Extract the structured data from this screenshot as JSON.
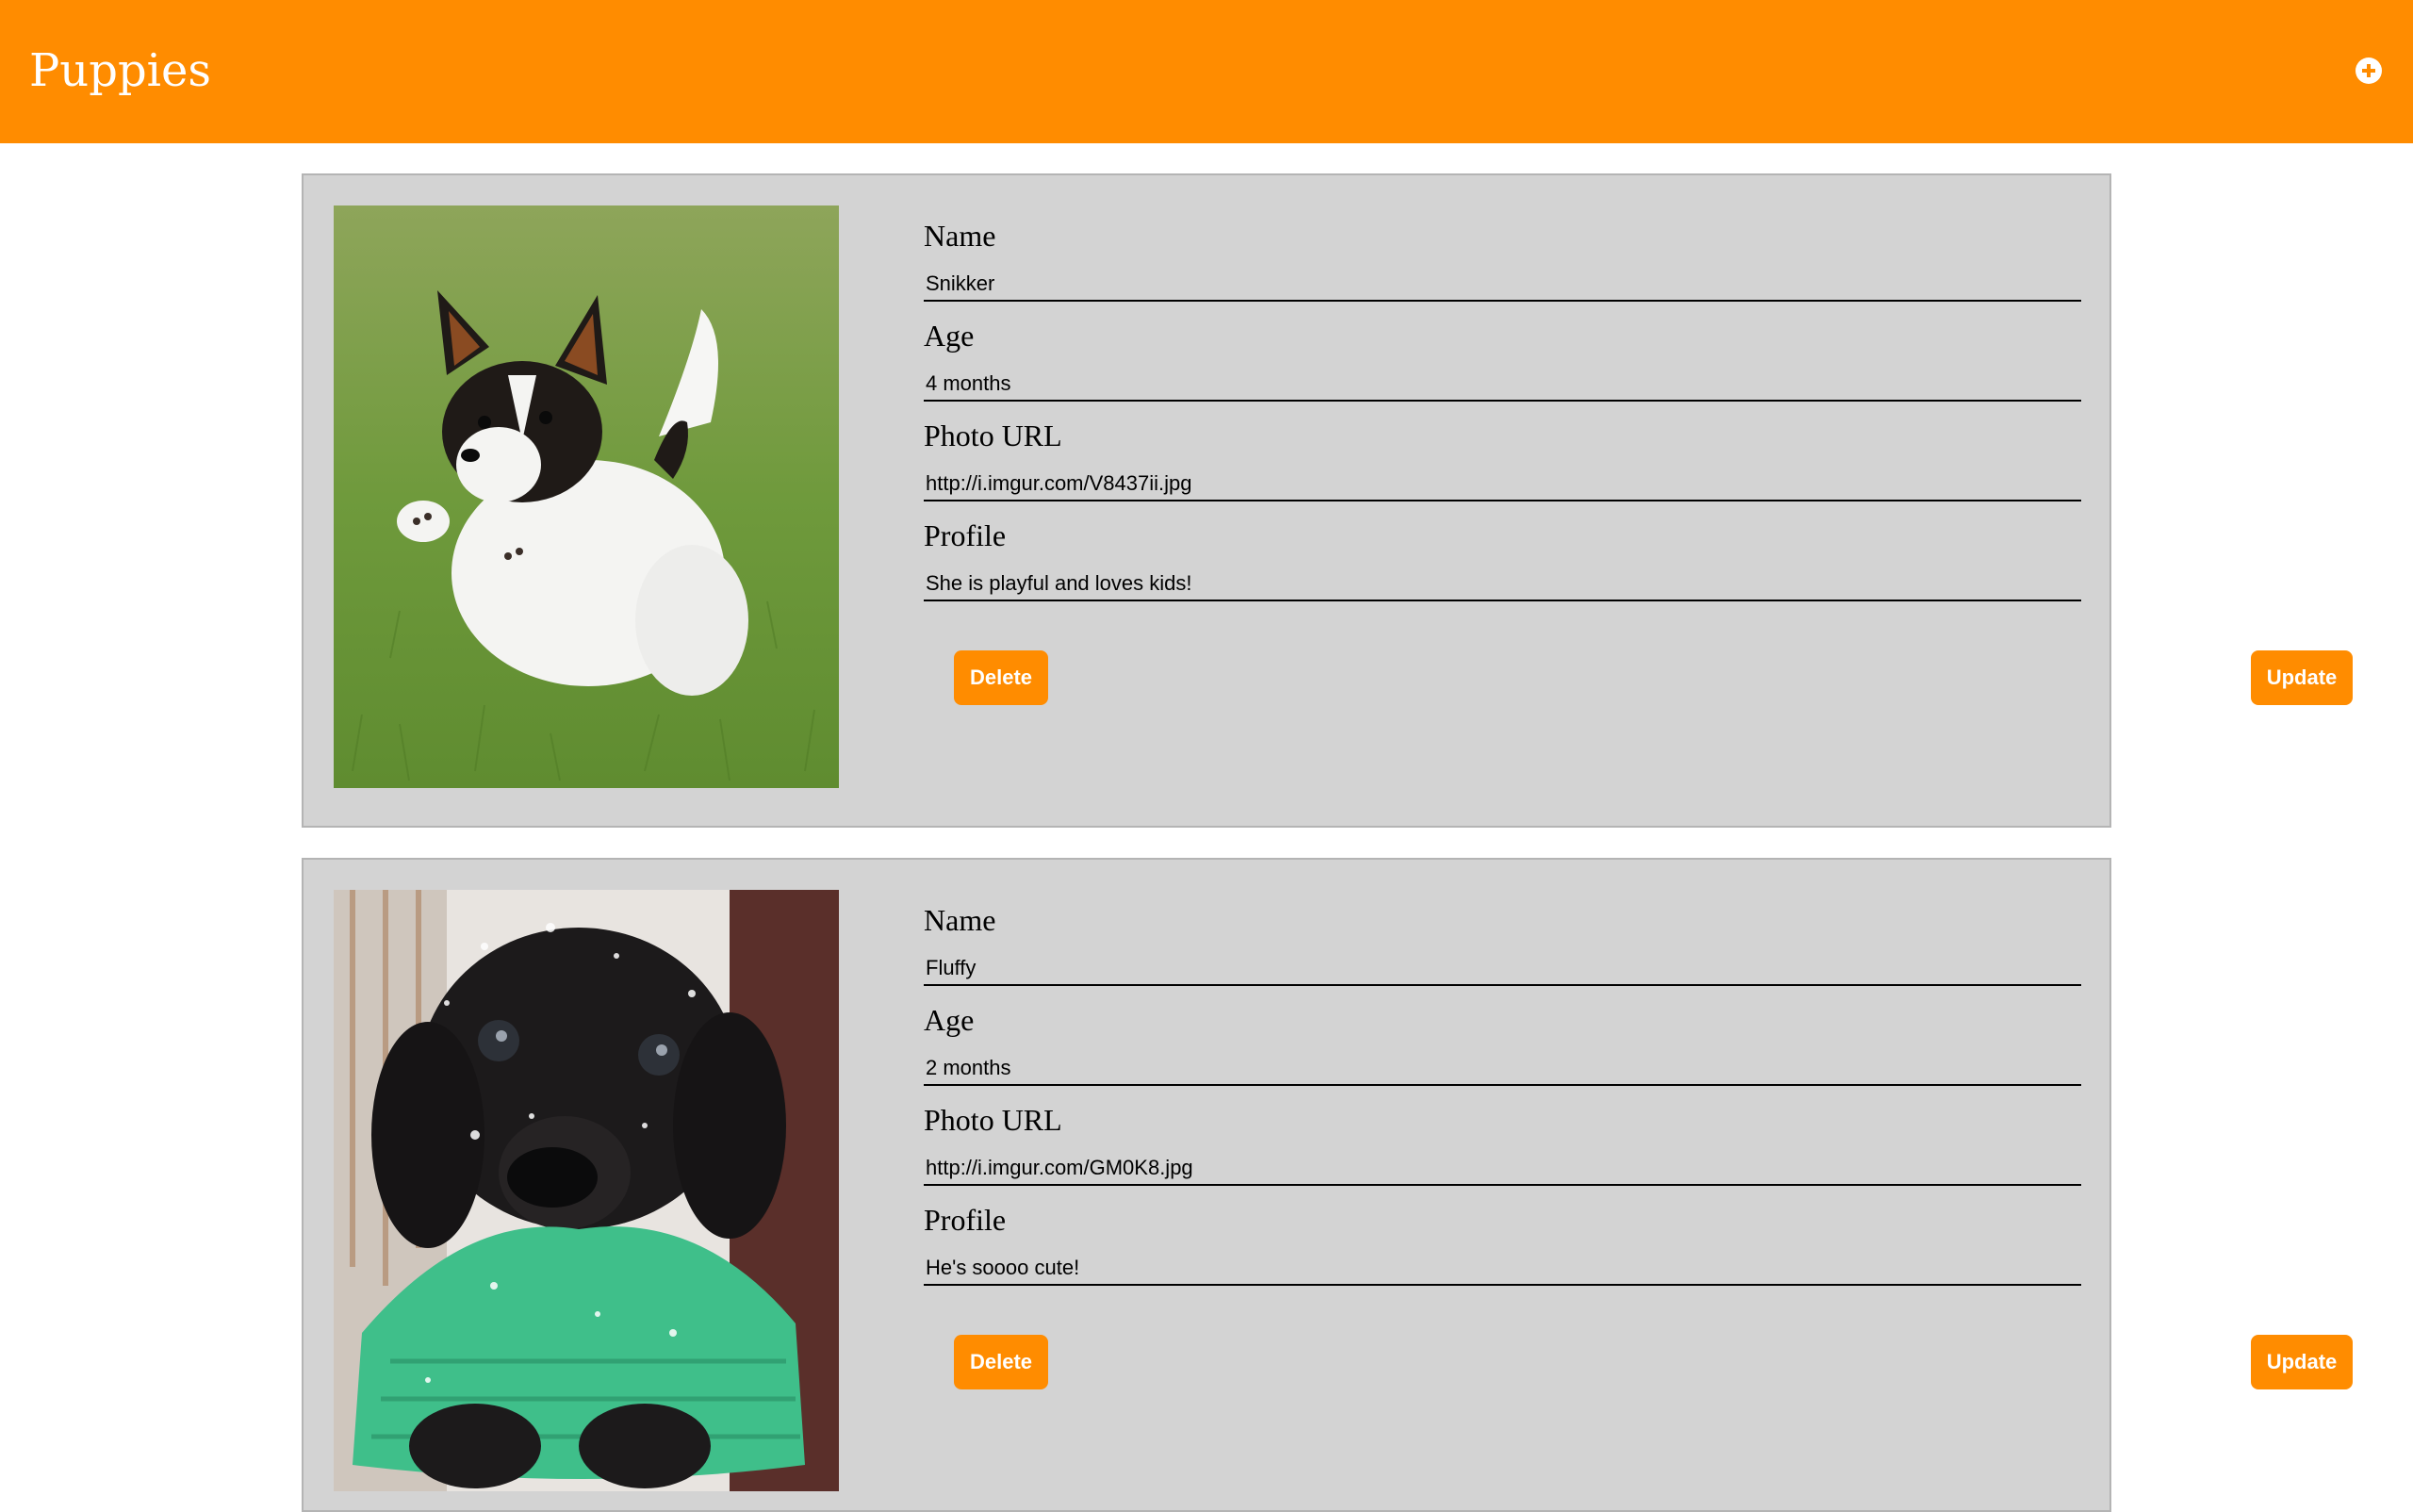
{
  "header": {
    "title": "Puppies",
    "add_icon": "plus-circle-icon"
  },
  "colors": {
    "accent": "#ff8c00",
    "card_bg": "#d3d3d3"
  },
  "puppies": [
    {
      "labels": {
        "name": "Name",
        "age": "Age",
        "photo_url": "Photo URL",
        "profile": "Profile"
      },
      "name": "Snikker",
      "age": "4 months",
      "photo_url": "http://i.imgur.com/V8437ii.jpg",
      "profile": "She is playful and loves kids!",
      "delete_label": "Delete",
      "update_label": "Update"
    },
    {
      "labels": {
        "name": "Name",
        "age": "Age",
        "photo_url": "Photo URL",
        "profile": "Profile"
      },
      "name": "Fluffy",
      "age": "2 months",
      "photo_url": "http://i.imgur.com/GM0K8.jpg",
      "profile": "He's soooo cute!",
      "delete_label": "Delete",
      "update_label": "Update"
    }
  ]
}
